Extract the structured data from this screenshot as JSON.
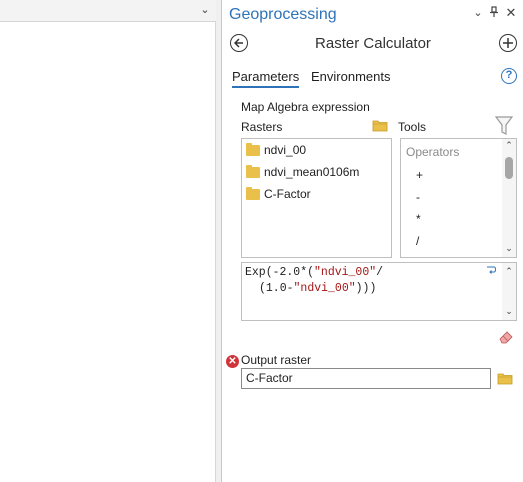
{
  "panel": {
    "title": "Geoprocessing",
    "tool_name": "Raster Calculator",
    "header_icons": [
      "chevron-down-icon",
      "pin-icon",
      "close-icon"
    ]
  },
  "tabs": [
    {
      "label": "Parameters",
      "active": true
    },
    {
      "label": "Environments",
      "active": false
    }
  ],
  "map_algebra": {
    "label": "Map Algebra expression",
    "rasters_label": "Rasters",
    "tools_label": "Tools",
    "rasters": [
      "ndvi_00",
      "ndvi_mean0106m",
      "C-Factor"
    ],
    "operators_header": "Operators",
    "operators": [
      "+",
      "-",
      "*",
      "/"
    ],
    "expression_line1_a": "Exp(-2.0*(",
    "expression_line1_str": "\"ndvi_00\"",
    "expression_line1_b": "/",
    "expression_line2_a": "(1.0-",
    "expression_line2_str": "\"ndvi_00\"",
    "expression_line2_b": ")))"
  },
  "output": {
    "label": "Output raster",
    "value": "C-Factor"
  },
  "colors": {
    "accent": "#2e73b8",
    "error": "#d13438",
    "folder": "#e9c14a"
  }
}
